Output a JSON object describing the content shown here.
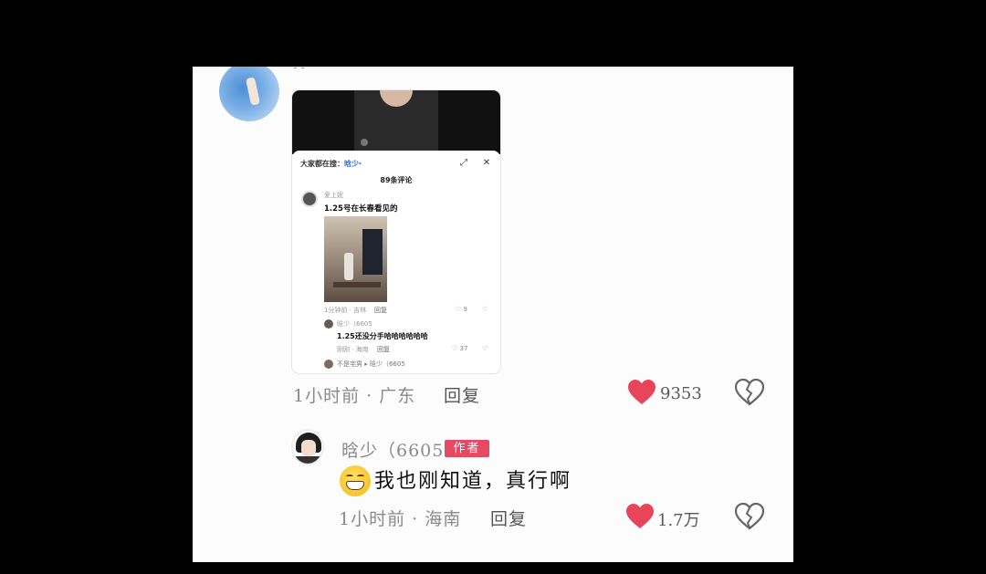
{
  "top_comment": {
    "username": "-'-",
    "screenshot": {
      "search_prefix": "大家都在搜：",
      "search_keyword": "晗少",
      "comment_count": "89条评论",
      "comments": [
        {
          "user": "爱上妮",
          "text": "1.25号在长春看见的",
          "meta": "1分钟前 · 吉林",
          "reply": "回复",
          "likes": "9"
        },
        {
          "user": "晗少（6605",
          "text": "1.25还没分手哈哈哈哈哈哈",
          "meta": "刚刚 · 海南",
          "reply": "回复",
          "likes": "37"
        },
        {
          "user": "不是宅男 ▸ 晗少（6605"
        }
      ]
    },
    "meta": "1小时前 · 广东",
    "reply": "回复",
    "likes": "9353"
  },
  "author_comment": {
    "username": "晗少（6605",
    "author_tag": "作者",
    "text": "我也刚知道，真行啊",
    "meta": "1小时前 · 海南",
    "reply": "回复",
    "likes": "1.7万"
  },
  "colors": {
    "heart": "#e8455a",
    "author_tag": "#e64963",
    "background": "#fdfcfc"
  },
  "icons": [
    "heart-icon",
    "broken-heart-icon",
    "grin-emoji-icon",
    "close-icon",
    "expand-icon"
  ]
}
